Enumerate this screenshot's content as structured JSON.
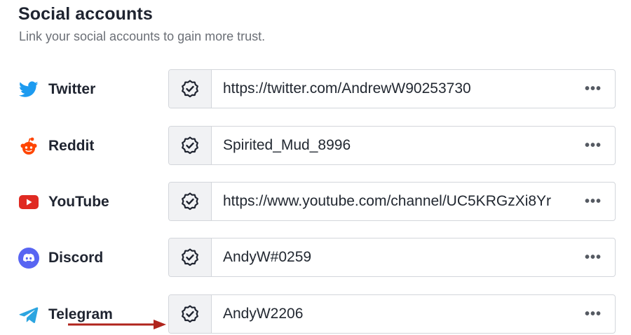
{
  "section": {
    "title": "Social accounts",
    "subtitle": "Link your social accounts to gain more trust."
  },
  "accounts": [
    {
      "platform": "Twitter",
      "icon": "twitter-icon",
      "value": "https://twitter.com/AndrewW90253730",
      "color": "#1d9bf0"
    },
    {
      "platform": "Reddit",
      "icon": "reddit-icon",
      "value": "Spirited_Mud_8996",
      "color": "#ff4500"
    },
    {
      "platform": "YouTube",
      "icon": "youtube-icon",
      "value": "https://www.youtube.com/channel/UC5KRGzXi8Yr",
      "color": "#e02a22"
    },
    {
      "platform": "Discord",
      "icon": "discord-icon",
      "value": "AndyW#0259",
      "color": "#5865f2"
    },
    {
      "platform": "Telegram",
      "icon": "telegram-icon",
      "value": "AndyW2206",
      "color": "#2ca5e0"
    }
  ],
  "more_label": "•••",
  "annotation": {
    "arrow_color": "#b0241c"
  }
}
